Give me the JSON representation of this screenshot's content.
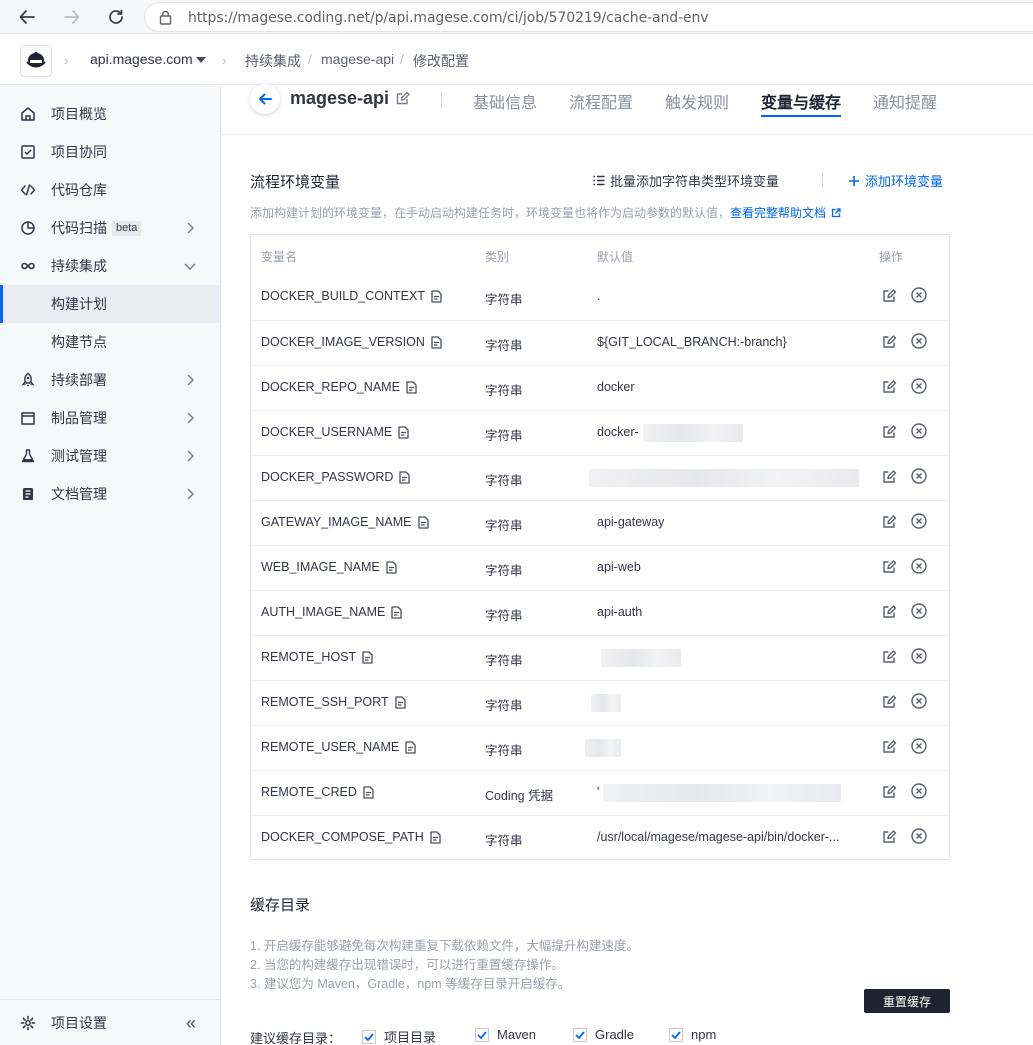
{
  "browser": {
    "url": "https://magese.coding.net/p/api.magese.com/ci/job/570219/cache-and-env"
  },
  "header": {
    "project": "api.magese.com",
    "breadcrumbs": [
      "持续集成",
      "magese-api",
      "修改配置"
    ]
  },
  "sidebar": {
    "items": [
      {
        "label": "项目概览",
        "icon": "home-icon"
      },
      {
        "label": "项目协同",
        "icon": "checkbox-icon"
      },
      {
        "label": "代码仓库",
        "icon": "code-icon"
      },
      {
        "label": "代码扫描",
        "icon": "scan-icon",
        "badge": "beta"
      },
      {
        "label": "持续集成",
        "icon": "infinity-icon"
      },
      {
        "label": "构建计划",
        "icon": ""
      },
      {
        "label": "构建节点",
        "icon": ""
      },
      {
        "label": "持续部署",
        "icon": "rocket-icon"
      },
      {
        "label": "制品管理",
        "icon": "package-icon"
      },
      {
        "label": "测试管理",
        "icon": "flask-icon"
      },
      {
        "label": "文档管理",
        "icon": "doc-icon"
      }
    ],
    "footer_label": "项目设置",
    "collapse_glyph": "«"
  },
  "job": {
    "name": "magese-api",
    "tabs": [
      "基础信息",
      "流程配置",
      "触发规则",
      "变量与缓存",
      "通知提醒"
    ],
    "active_tab": "变量与缓存"
  },
  "env_section": {
    "title": "流程环境变量",
    "batch_add": "批量添加字符串类型环境变量",
    "add": "添加环境变量",
    "hint": "添加构建计划的环境变量，在手动启动构建任务时，环境变量也将作为启动参数的默认值，",
    "help_link": "查看完整帮助文档",
    "columns": [
      "变量名",
      "类别",
      "默认值",
      "操作"
    ],
    "rows": [
      {
        "name": "DOCKER_BUILD_CONTEXT",
        "type": "字符串",
        "value": "."
      },
      {
        "name": "DOCKER_IMAGE_VERSION",
        "type": "字符串",
        "value": "${GIT_LOCAL_BRANCH:-branch}"
      },
      {
        "name": "DOCKER_REPO_NAME",
        "type": "字符串",
        "value": "docker"
      },
      {
        "name": "DOCKER_USERNAME",
        "type": "字符串",
        "value": "docker-"
      },
      {
        "name": "DOCKER_PASSWORD",
        "type": "字符串",
        "value": ""
      },
      {
        "name": "GATEWAY_IMAGE_NAME",
        "type": "字符串",
        "value": "api-gateway"
      },
      {
        "name": "WEB_IMAGE_NAME",
        "type": "字符串",
        "value": "api-web"
      },
      {
        "name": "AUTH_IMAGE_NAME",
        "type": "字符串",
        "value": "api-auth"
      },
      {
        "name": "REMOTE_HOST",
        "type": "字符串",
        "value": ""
      },
      {
        "name": "REMOTE_SSH_PORT",
        "type": "字符串",
        "value": ""
      },
      {
        "name": "REMOTE_USER_NAME",
        "type": "字符串",
        "value": ""
      },
      {
        "name": "REMOTE_CRED",
        "type": "Coding 凭据",
        "value": "'"
      },
      {
        "name": "DOCKER_COMPOSE_PATH",
        "type": "字符串",
        "value": "/usr/local/magese/magese-api/bin/docker-..."
      }
    ]
  },
  "cache_section": {
    "title": "缓存目录",
    "lines": [
      "1. 开启缓存能够避免每次构建重复下载依赖文件，大幅提升构建速度。",
      "2. 当您的构建缓存出现错误时，可以进行重置缓存操作。",
      "3. 建议您为 Maven，Gradle，npm 等缓存目录开启缓存。"
    ],
    "reset_button": "重置缓存",
    "suggest_label": "建议缓存目录：",
    "options": [
      {
        "label": "项目目录",
        "checked": true
      },
      {
        "label": "Maven",
        "checked": true
      },
      {
        "label": "Gradle",
        "checked": true
      },
      {
        "label": "npm",
        "checked": true
      }
    ]
  },
  "colors": {
    "accent": "#0066ff",
    "text": "#323645",
    "muted": "#9aa0ab",
    "dark_button": "#1f2330"
  }
}
